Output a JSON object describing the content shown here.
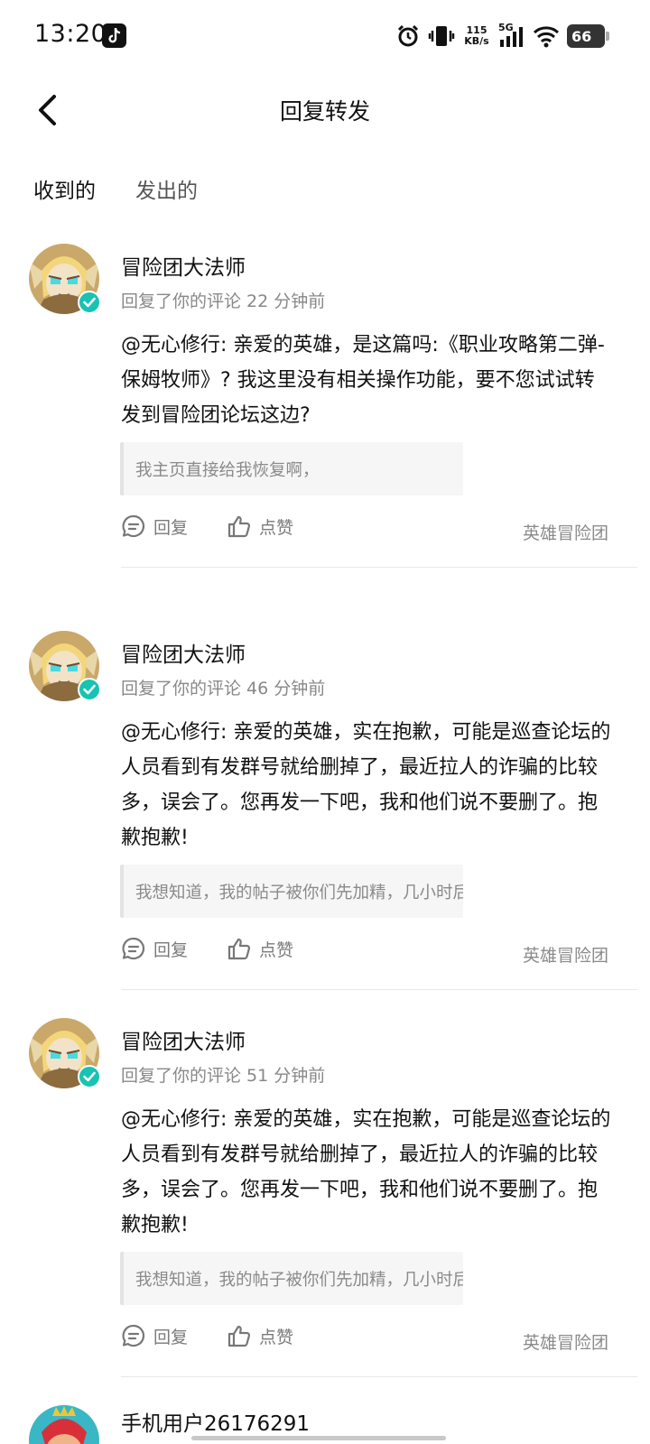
{
  "status_bar": {
    "time": "13:20",
    "net_speed_value": "115",
    "net_speed_unit": "KB/s",
    "network_type": "5G",
    "battery": "66"
  },
  "header": {
    "title": "回复转发"
  },
  "tabs": [
    {
      "label": "收到的",
      "active": true
    },
    {
      "label": "发出的",
      "active": false
    }
  ],
  "items": [
    {
      "user": "冒险团大法师",
      "meta": "回复了你的评论 22 分钟前",
      "text": "@无心修行: 亲爱的英雄，是这篇吗:《职业攻略第二弹-保姆牧师》? 我这里没有相关操作功能，要不您试试转发到冒险团论坛这边?",
      "quote": "我主页直接给我恢复啊，",
      "reply_label": "回复",
      "like_label": "点赞",
      "source": "英雄冒险团"
    },
    {
      "user": "冒险团大法师",
      "meta": "回复了你的评论 46 分钟前",
      "text": "@无心修行: 亲爱的英雄，实在抱歉，可能是巡查论坛的人员看到有发群号就给删掉了，最近拉人的诈骗的比较多，误会了。您再发一下吧，我和他们说不要删了。抱歉抱歉!",
      "quote": "我想知道，我的帖子被你们先加精，几小时后又移…",
      "reply_label": "回复",
      "like_label": "点赞",
      "source": "英雄冒险团"
    },
    {
      "user": "冒险团大法师",
      "meta": "回复了你的评论 51 分钟前",
      "text": "@无心修行: 亲爱的英雄，实在抱歉，可能是巡查论坛的人员看到有发群号就给删掉了，最近拉人的诈骗的比较多，误会了。您再发一下吧，我和他们说不要删了。抱歉抱歉!",
      "quote": "我想知道，我的帖子被你们先加精，几小时后又移…",
      "reply_label": "回复",
      "like_label": "点赞",
      "source": "英雄冒险团"
    },
    {
      "user": "手机用户26176291"
    }
  ],
  "colors": {
    "accent": "#1fcfc1",
    "verified": "#17c3b2"
  }
}
